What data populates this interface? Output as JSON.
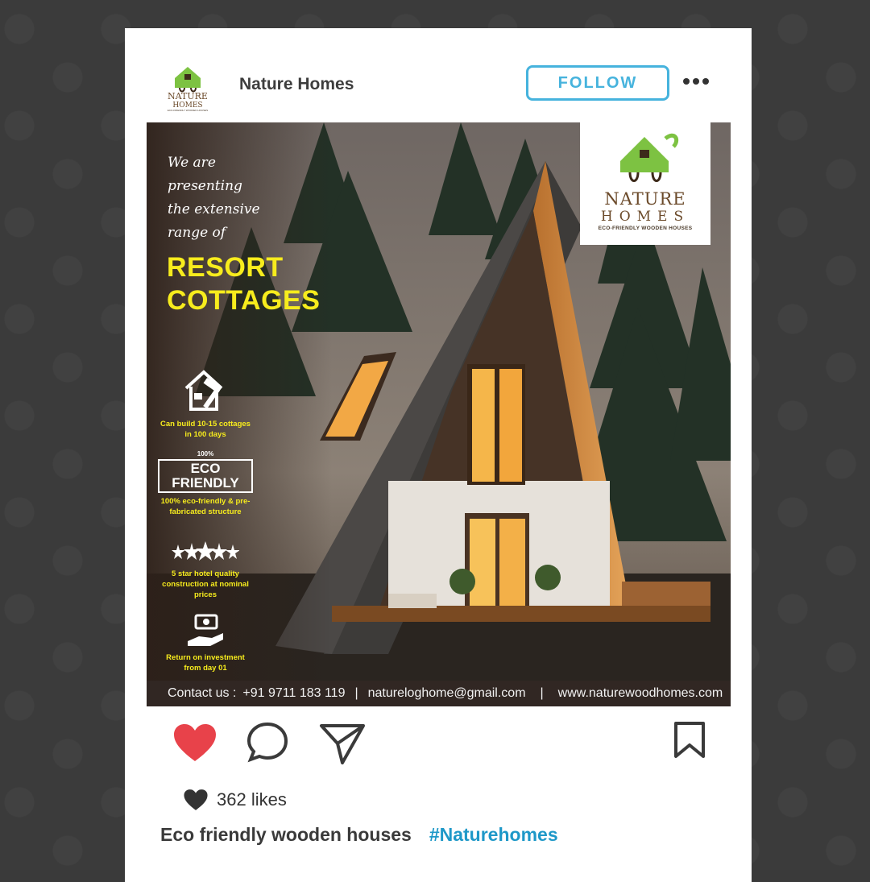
{
  "account": {
    "name": "Nature Homes",
    "follow_label": "FOLLOW"
  },
  "post": {
    "tagline_lines": [
      "We are",
      "presenting",
      "the extensive",
      "range of"
    ],
    "headline_lines": [
      "RESORT",
      "COTTAGES"
    ],
    "features": [
      {
        "icon": "house-hammer-icon",
        "text": "Can build 10-15 cottages in 100 days"
      },
      {
        "icon": "eco-friendly-badge-icon",
        "badge": "ECO FRIENDLY",
        "badge_top": "100%",
        "text": "100% eco-friendly & pre-fabricated structure"
      },
      {
        "icon": "five-stars-icon",
        "text": "5 star hotel quality construction at nominal prices"
      },
      {
        "icon": "money-hand-icon",
        "text": "Return on investment from day 01"
      }
    ],
    "brand": {
      "name_line1": "NATURE",
      "name_line2": "HOMES",
      "tagline": "ECO-FRIENDLY WOODEN HOUSES"
    },
    "contact": {
      "label": "Contact us :",
      "phone": "+91 9711 183 119",
      "separator": "|",
      "email": "natureloghome@gmail.com",
      "website": "www.naturewoodhomes.com"
    }
  },
  "engagement": {
    "likes": "362 likes"
  },
  "caption": {
    "text": "Eco friendly wooden houses",
    "hashtag": "#Naturehomes"
  },
  "colors": {
    "follow": "#46b3dd",
    "like_red": "#e8424a",
    "headline_yellow": "#f7ec1d",
    "hashtag": "#1e98c8",
    "brand_green": "#7dc242"
  }
}
